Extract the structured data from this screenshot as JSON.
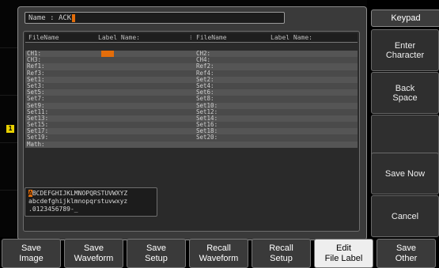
{
  "name_field": {
    "prefix": "Name : ",
    "value": "ACK"
  },
  "file_header": {
    "col1": "FileName",
    "col2": "Label Name:",
    "col3": "FileName",
    "col4": "Label Name:"
  },
  "file_rows": [
    [
      "CH1:",
      "CH2:"
    ],
    [
      "CH3:",
      "CH4:"
    ],
    [
      "Ref1:",
      "Ref2:"
    ],
    [
      "Ref3:",
      "Ref4:"
    ],
    [
      "Set1:",
      "Set2:"
    ],
    [
      "Set3:",
      "Set4:"
    ],
    [
      "Set5:",
      "Set6:"
    ],
    [
      "Set7:",
      "Set8:"
    ],
    [
      "Set9:",
      "Set10:"
    ],
    [
      "Set11:",
      "Set12:"
    ],
    [
      "Set13:",
      "Set14:"
    ],
    [
      "Set15:",
      "Set16:"
    ],
    [
      "Set17:",
      "Set18:"
    ],
    [
      "Set19:",
      "Set20:"
    ],
    [
      "Math:",
      ""
    ]
  ],
  "keypad": {
    "selected": "A",
    "line1_rest": "BCDEFGHIJKLMNOPQRSTUVWXYZ",
    "line2": "abcdefghijklmnopqrstuvwxyz",
    "line3": ".0123456789-_"
  },
  "markers": {
    "channel": "1",
    "trigger": "T"
  },
  "side_menu": {
    "title": "Keypad",
    "buttons": [
      {
        "line1": "Enter",
        "line2": "Character"
      },
      {
        "line1": "Back",
        "line2": "Space"
      },
      {
        "line1": "",
        "line2": ""
      },
      {
        "line1": "Save Now",
        "line2": ""
      },
      {
        "line1": "Cancel",
        "line2": ""
      }
    ]
  },
  "bottom_menu": [
    {
      "line1": "Save",
      "line2": "Image",
      "active": false
    },
    {
      "line1": "Save",
      "line2": "Waveform",
      "active": false
    },
    {
      "line1": "Save",
      "line2": "Setup",
      "active": false
    },
    {
      "line1": "Recall",
      "line2": "Waveform",
      "active": false
    },
    {
      "line1": "Recall",
      "line2": "Setup",
      "active": false
    },
    {
      "line1": "Edit",
      "line2": "File Label",
      "active": true
    },
    {
      "line1": "Save",
      "line2": "Other",
      "active": false
    }
  ],
  "colors": {
    "accent": "#e36d0a",
    "channel1": "#e8d000"
  }
}
